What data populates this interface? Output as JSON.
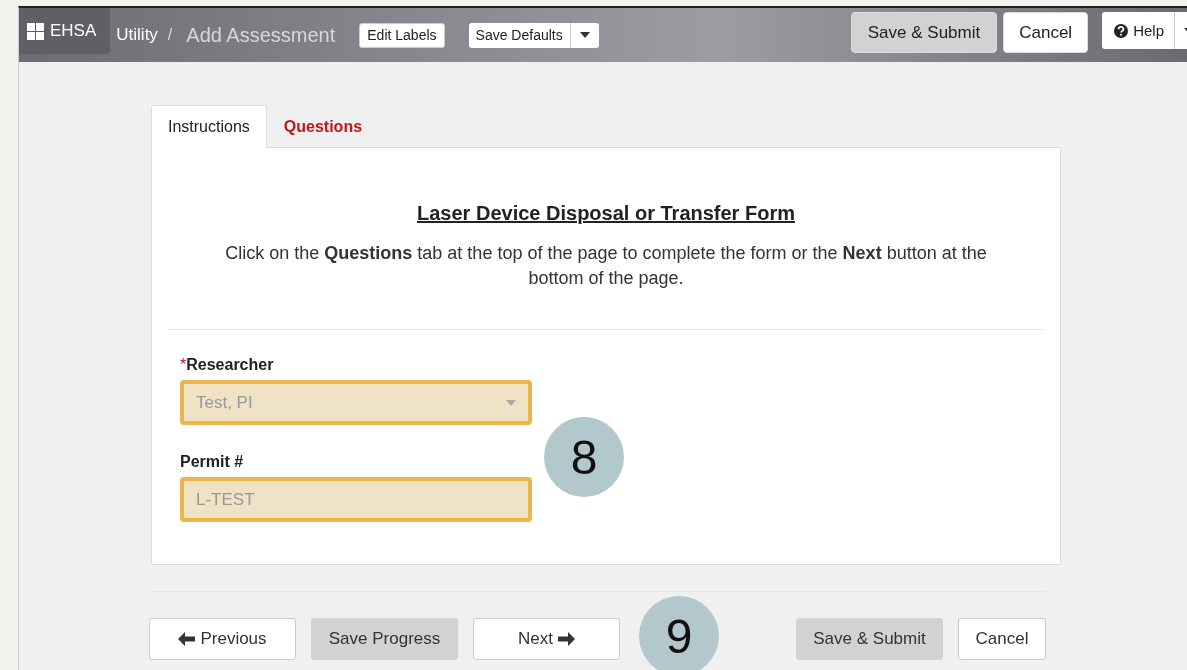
{
  "header": {
    "brand": "EHSA",
    "breadcrumb": [
      {
        "label": "Utility",
        "current": false
      },
      {
        "label": "Add Assessment",
        "current": true
      }
    ],
    "separator": "/",
    "tools": [
      {
        "label": "Edit Labels",
        "split": false
      },
      {
        "label": "Save Defaults",
        "split": true
      }
    ],
    "actions": [
      {
        "label": "Save & Submit",
        "kind": "primary"
      },
      {
        "label": "Cancel",
        "kind": "default"
      }
    ],
    "help": {
      "label": "Help",
      "split": true
    }
  },
  "tabs": [
    {
      "label": "Instructions",
      "selected": true
    },
    {
      "label": "Questions",
      "selected": false
    }
  ],
  "form": {
    "title": "Laser Device Disposal or Transfer Form",
    "instructions": "Click on the **Questions** tab at the top of the page to complete the form or the **Next** button at the bottom of the page.",
    "fields": [
      {
        "label": "Researcher",
        "required_mark": "*",
        "kind": "select",
        "value": "Test, PI",
        "highlighted": true
      },
      {
        "label": "Permit #",
        "kind": "text",
        "value": "L-TEST",
        "highlighted": true
      }
    ]
  },
  "footer": {
    "left": [
      {
        "label": "Previous",
        "kind": "back"
      },
      {
        "label": "Save Progress",
        "kind": "primary"
      },
      {
        "label": "Next",
        "kind": "forward"
      }
    ],
    "right": [
      {
        "label": "Save & Submit",
        "kind": "primary"
      },
      {
        "label": "Cancel",
        "kind": "default"
      }
    ]
  },
  "callouts": [
    {
      "number": "8"
    },
    {
      "number": "9"
    }
  ]
}
